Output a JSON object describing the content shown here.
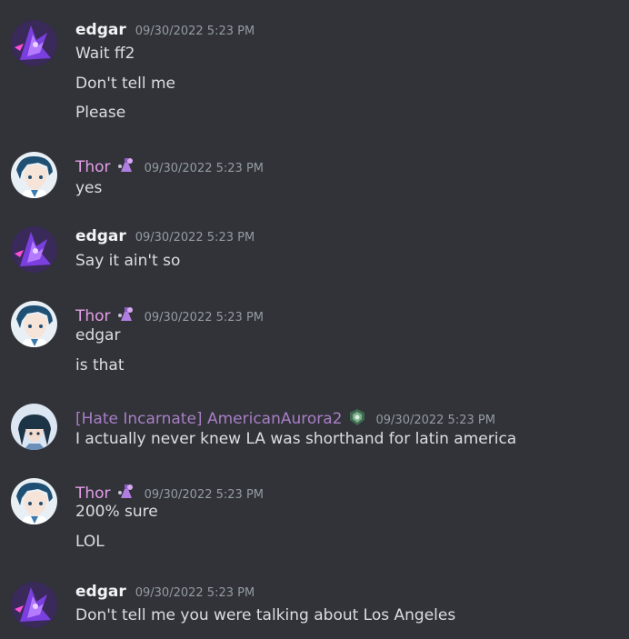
{
  "colors": {
    "background": "#313338",
    "text": "#dbdee1",
    "timestamp": "#949ba4",
    "edgar": "#f2f3f5",
    "thor": "#e39ee8",
    "aurora": "#a87ec6"
  },
  "messages": [
    {
      "author": "edgar",
      "timestamp": "09/30/2022 5:23 PM",
      "avatar_icon": "purple-creature-avatar",
      "lines": [
        "Wait ff2",
        "Don't tell me",
        "Please"
      ]
    },
    {
      "author": "Thor",
      "role_icon": "purple-bottle-icon",
      "timestamp": "09/30/2022 5:23 PM",
      "avatar_icon": "anime-boy-avatar",
      "lines": [
        "yes"
      ]
    },
    {
      "author": "edgar",
      "timestamp": "09/30/2022 5:23 PM",
      "avatar_icon": "purple-creature-avatar",
      "lines": [
        "Say it ain't so"
      ]
    },
    {
      "author": "Thor",
      "role_icon": "purple-bottle-icon",
      "timestamp": "09/30/2022 5:23 PM",
      "avatar_icon": "anime-boy-avatar",
      "lines": [
        "edgar",
        "is that"
      ]
    },
    {
      "author": "[Hate Incarnate] AmericanAurora2",
      "role_icon": "green-emblem-icon",
      "timestamp": "09/30/2022 5:23 PM",
      "avatar_icon": "anime-girl-avatar",
      "lines": [
        "I actually never knew LA was shorthand for latin america"
      ]
    },
    {
      "author": "Thor",
      "role_icon": "purple-bottle-icon",
      "timestamp": "09/30/2022 5:23 PM",
      "avatar_icon": "anime-boy-avatar",
      "lines": [
        "200% sure",
        "LOL"
      ]
    },
    {
      "author": "edgar",
      "timestamp": "09/30/2022 5:23 PM",
      "avatar_icon": "purple-creature-avatar",
      "lines": [
        "Don't tell me you were talking about Los Angeles"
      ]
    }
  ]
}
